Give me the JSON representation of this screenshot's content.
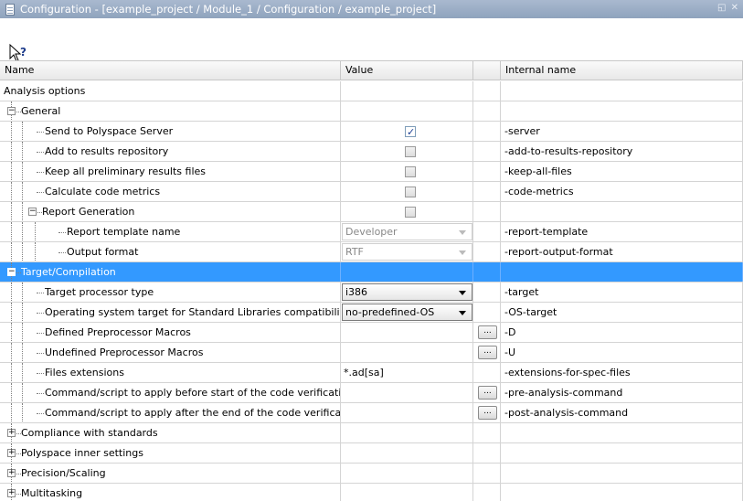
{
  "window": {
    "title": "Configuration - [example_project / Module_1 / Configuration / example_project]",
    "controls": "◱ ✕"
  },
  "toolbar": {
    "help_icon": "context-help-icon"
  },
  "columns": {
    "name": "Name",
    "value": "Value",
    "internal": "Internal name"
  },
  "rows": [
    {
      "name": "Analysis options",
      "internal": ""
    },
    {
      "name": "General",
      "internal": "",
      "toggle": "−"
    },
    {
      "name": "Send to Polyspace Server",
      "checked": true,
      "internal": "-server"
    },
    {
      "name": "Add to results repository",
      "checked": false,
      "internal": "-add-to-results-repository"
    },
    {
      "name": "Keep all preliminary results files",
      "checked": false,
      "internal": "-keep-all-files"
    },
    {
      "name": "Calculate code metrics",
      "checked": false,
      "internal": "-code-metrics"
    },
    {
      "name": "Report Generation",
      "checked": false,
      "internal": "",
      "toggle": "−"
    },
    {
      "name": "Report template name",
      "value": "Developer",
      "internal": "-report-template"
    },
    {
      "name": "Output format",
      "value": "RTF",
      "internal": "-report-output-format"
    },
    {
      "name": "Target/Compilation",
      "internal": "",
      "toggle": "−",
      "selected": true
    },
    {
      "name": "Target processor type",
      "value": "i386",
      "internal": "-target"
    },
    {
      "name": "Operating system target for Standard Libraries compatibility",
      "value": "no-predefined-OS",
      "internal": "-OS-target"
    },
    {
      "name": "Defined Preprocessor Macros",
      "value": "",
      "button": "...",
      "internal": "-D"
    },
    {
      "name": "Undefined Preprocessor Macros",
      "value": "",
      "button": "...",
      "internal": "-U"
    },
    {
      "name": "Files extensions",
      "value": "*.ad[sa]",
      "internal": "-extensions-for-spec-files"
    },
    {
      "name": "Command/script to apply before start of the code verification",
      "value": "",
      "button": "...",
      "internal": "-pre-analysis-command"
    },
    {
      "name": "Command/script to apply after the end of the code verification",
      "value": "",
      "button": "...",
      "internal": "-post-analysis-command"
    },
    {
      "name": "Compliance with standards",
      "internal": "",
      "toggle": "+"
    },
    {
      "name": "Polyspace inner settings",
      "internal": "",
      "toggle": "+"
    },
    {
      "name": "Precision/Scaling",
      "internal": "",
      "toggle": "+"
    },
    {
      "name": "Multitasking",
      "internal": "",
      "toggle": "+"
    }
  ]
}
